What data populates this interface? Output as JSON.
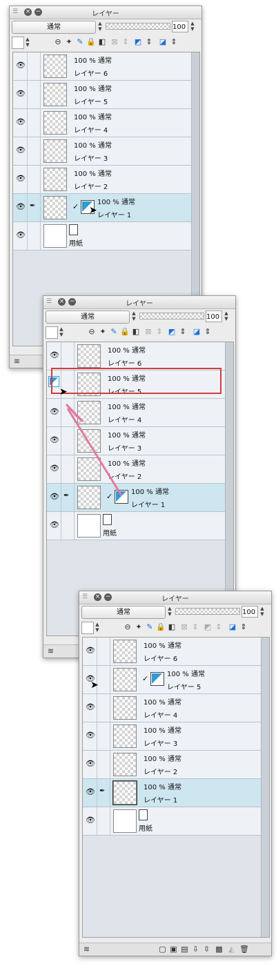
{
  "panel_title": "レイヤー",
  "blend_mode": "通常",
  "opacity_value": "100",
  "paper_name": "用紙",
  "paper_mode": "",
  "icons": {
    "menu_grip": "menu-grip-icon",
    "close": "close-icon",
    "minimize": "minimize-icon",
    "eye": "eye-icon",
    "pen": "pen-icon",
    "check": "checkmark-icon",
    "mask": "layer-mask-icon",
    "paper": "paper-icon",
    "layer_stack": "layer-stack-icon",
    "cursor": "mouse-cursor-icon"
  },
  "colors": {
    "selected_row": "#cde6f0",
    "mask_blue": "#2f9bd6",
    "highlight_red": "#d23b3b",
    "drag_arrow": "#e07aa3"
  },
  "panel1": {
    "layers": [
      {
        "mode": "100 % 通常",
        "name": "レイヤー 6"
      },
      {
        "mode": "100 % 通常",
        "name": "レイヤー 5"
      },
      {
        "mode": "100 % 通常",
        "name": "レイヤー 4"
      },
      {
        "mode": "100 % 通常",
        "name": "レイヤー 3"
      },
      {
        "mode": "100 % 通常",
        "name": "レイヤー 2"
      },
      {
        "mode": "100 % 通常",
        "name": "レイヤー 1",
        "selected": true
      }
    ]
  },
  "panel2": {
    "layers": [
      {
        "mode": "100 % 通常",
        "name": "レイヤー 6"
      },
      {
        "mode": "100 % 通常",
        "name": "レイヤー 5",
        "highlighted": true
      },
      {
        "mode": "100 % 通常",
        "name": "レイヤー 4"
      },
      {
        "mode": "100 % 通常",
        "name": "レイヤー 3"
      },
      {
        "mode": "100 % 通常",
        "name": "レイヤー 2"
      },
      {
        "mode": "100 % 通常",
        "name": "レイヤー 1",
        "selected": true
      }
    ]
  },
  "panel3": {
    "layers": [
      {
        "mode": "100 % 通常",
        "name": "レイヤー 6"
      },
      {
        "mode": "100 % 通常",
        "name": "レイヤー 5"
      },
      {
        "mode": "100 % 通常",
        "name": "レイヤー 4"
      },
      {
        "mode": "100 % 通常",
        "name": "レイヤー 3"
      },
      {
        "mode": "100 % 通常",
        "name": "レイヤー 2"
      },
      {
        "mode": "100 % 通常",
        "name": "レイヤー 1",
        "selected": true
      }
    ]
  }
}
